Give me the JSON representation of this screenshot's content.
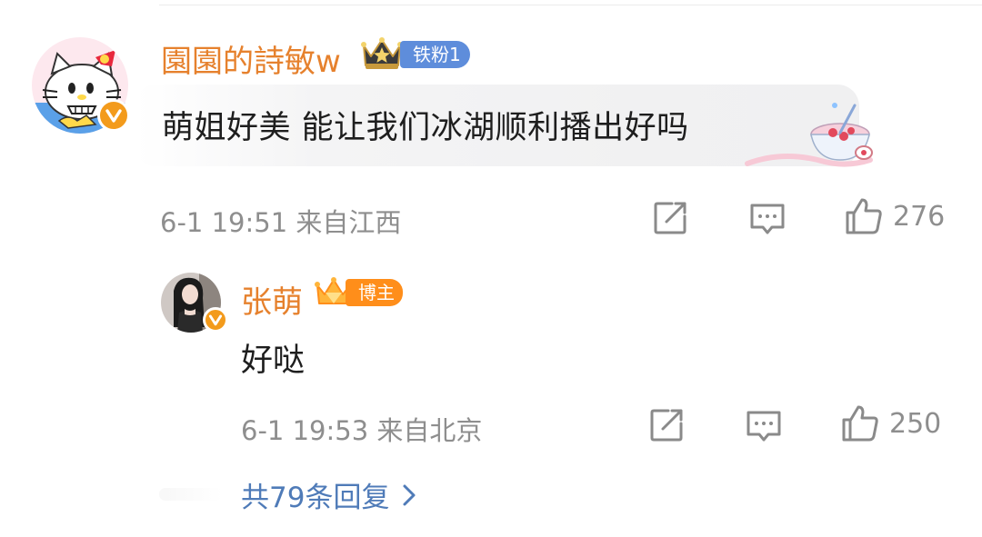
{
  "comment": {
    "username": "園園的詩敏w",
    "fan_badge": "铁粉1",
    "text": "萌姐好美 能让我们冰湖顺利播出好吗",
    "meta": "6-1 19:51 来自江西",
    "likes": "276"
  },
  "reply": {
    "username": "张萌",
    "role_badge": "博主",
    "text": "好哒",
    "meta": "6-1 19:53 来自北京",
    "likes": "250"
  },
  "more_replies": {
    "label": "共79条回复"
  },
  "icons": {
    "share": "share-icon",
    "comment": "comment-icon",
    "like": "thumbs-up-icon",
    "verified": "verified-v-icon",
    "more": "chevron-right-icon"
  },
  "colors": {
    "username": "#e6812d",
    "link": "#4f7bb8",
    "fan_badge": "#5e8ddb",
    "blogger_badge": "#ff8e1a",
    "verified": "#f39b1c",
    "meta_text": "#8e8e8e"
  }
}
